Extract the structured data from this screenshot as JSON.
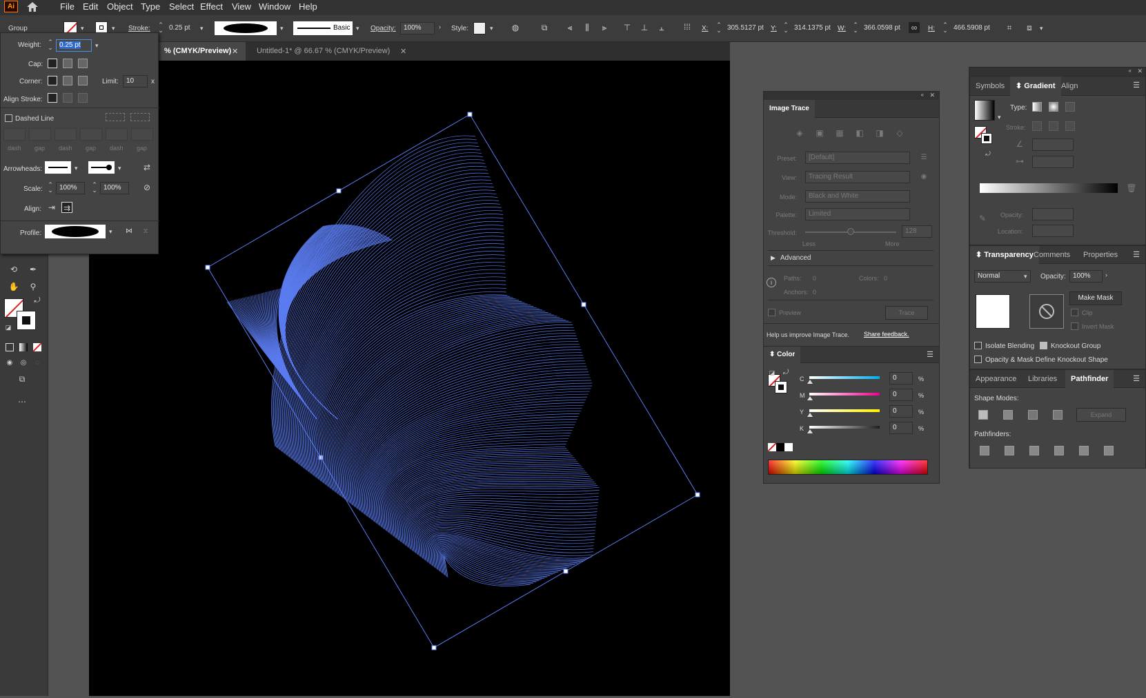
{
  "menubar": {
    "logo": "Ai",
    "home_icon": "home-icon",
    "items": [
      "File",
      "Edit",
      "Object",
      "Type",
      "Select",
      "Effect",
      "View",
      "Window",
      "Help"
    ]
  },
  "control": {
    "selection": "Group",
    "stroke_label": "Stroke:",
    "stroke_weight": "0.25 pt",
    "brush_label": "Basic",
    "opacity_label": "Opacity:",
    "opacity_value": "100%",
    "style_label": "Style:",
    "x_label": "X:",
    "x_value": "305.5127 pt",
    "y_label": "Y:",
    "y_value": "314.1375 pt",
    "w_label": "W:",
    "w_value": "366.0598 pt",
    "h_label": "H:",
    "h_value": "466.5908 pt"
  },
  "tabs": [
    {
      "label": "% (CMYK/Preview)"
    },
    {
      "label": "Untitled-1* @ 66.67 % (CMYK/Preview)"
    }
  ],
  "stroke_panel": {
    "weight_label": "Weight:",
    "weight_value": "0.25 pt",
    "cap_label": "Cap:",
    "corner_label": "Corner:",
    "limit_label": "Limit:",
    "limit_value": "10",
    "limit_x": "x",
    "align_label": "Align Stroke:",
    "dashed_label": "Dashed Line",
    "dash_labels": [
      "dash",
      "gap",
      "dash",
      "gap",
      "dash",
      "gap"
    ],
    "arrowheads_label": "Arrowheads:",
    "scale_label": "Scale:",
    "scale_start": "100%",
    "scale_end": "100%",
    "align2_label": "Align:",
    "profile_label": "Profile:"
  },
  "image_trace": {
    "title": "Image Trace",
    "preset_label": "Preset:",
    "preset_value": "[Default]",
    "view_label": "View:",
    "view_value": "Tracing Result",
    "mode_label": "Mode:",
    "mode_value": "Black and White",
    "palette_label": "Palette:",
    "palette_value": "Limited",
    "threshold_label": "Threshold:",
    "threshold_value": "128",
    "threshold_level": 0.5,
    "less": "Less",
    "more": "More",
    "advanced": "Advanced",
    "paths_label": "Paths:",
    "paths_value": "0",
    "colors_label": "Colors:",
    "colors_value": "0",
    "anchors_label": "Anchors:",
    "anchors_value": "0",
    "preview_label": "Preview",
    "trace_label": "Trace",
    "help_text": "Help us improve Image Trace.",
    "feedback_link": "Share feedback."
  },
  "color_panel": {
    "title": "Color",
    "channels": [
      {
        "name": "C",
        "value": "0",
        "pct": "%",
        "color": "#00aeef"
      },
      {
        "name": "M",
        "value": "0",
        "pct": "%",
        "color": "#ec008c"
      },
      {
        "name": "Y",
        "value": "0",
        "pct": "%",
        "color": "#fff200"
      },
      {
        "name": "K",
        "value": "0",
        "pct": "%",
        "color": "#231f20"
      }
    ]
  },
  "gradient_panel": {
    "tabs": [
      "Symbols",
      "Gradient",
      "Align"
    ],
    "type_label": "Type:",
    "stroke_label": "Stroke:",
    "opacity_label": "Opacity:",
    "location_label": "Location:"
  },
  "transparency_panel": {
    "tabs": [
      "Transparency",
      "Comments",
      "Properties"
    ],
    "blend_mode": "Normal",
    "opacity_label": "Opacity:",
    "opacity_value": "100%",
    "make_mask": "Make Mask",
    "clip": "Clip",
    "invert_mask": "Invert Mask",
    "isolate": "Isolate Blending",
    "knockout": "Knockout Group",
    "opacity_mask": "Opacity & Mask Define Knockout Shape"
  },
  "pathfinder_panel": {
    "tabs": [
      "Appearance",
      "Libraries",
      "Pathfinder"
    ],
    "shape_modes": "Shape Modes:",
    "expand": "Expand",
    "pathfinders": "Pathfinders:"
  }
}
